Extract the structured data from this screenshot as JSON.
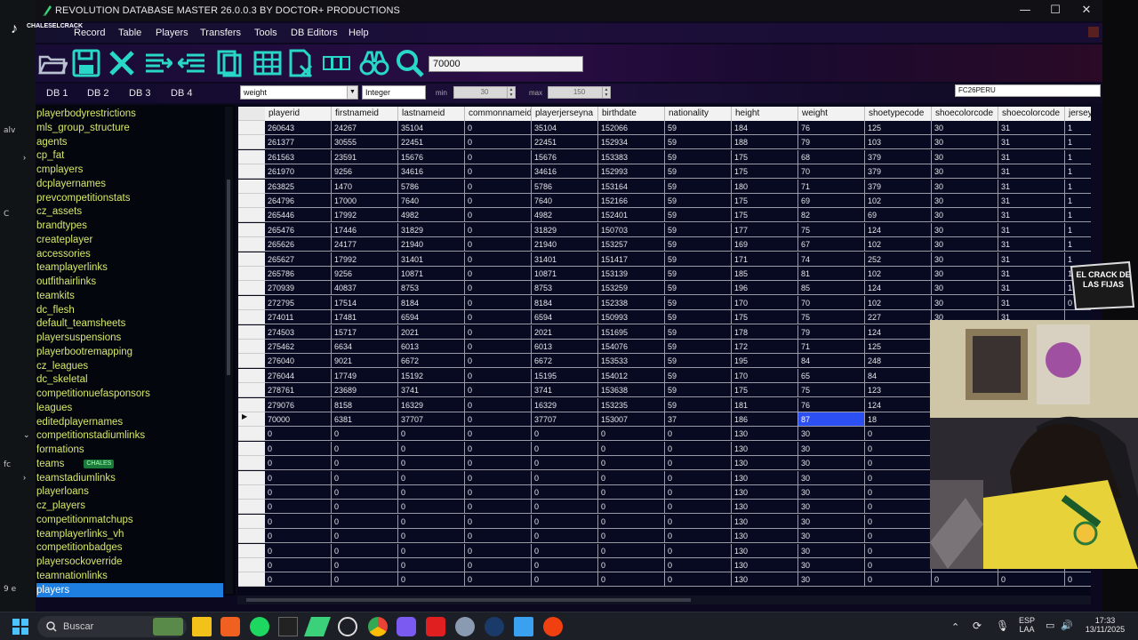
{
  "window": {
    "title": "REVOLUTION DATABASE MASTER 26.0.0.3 BY DOCTOR+ PRODUCTIONS",
    "minimize": "—",
    "maximize": "☐",
    "close": "✕"
  },
  "menu": [
    "Record",
    "Table",
    "Players",
    "Transfers",
    "Tools",
    "DB Editors",
    "Help"
  ],
  "search": {
    "value": "70000"
  },
  "db_tabs": [
    "DB 1",
    "DB 2",
    "DB 3",
    "DB 4"
  ],
  "field_bar": {
    "field": "weight",
    "type": "Integer",
    "min_label": "min",
    "min_value": "30",
    "max_label": "max",
    "max_value": "150",
    "filter": "FC26PERU"
  },
  "tables": [
    "playerbodyrestrictions",
    "mls_group_structure",
    "agents",
    "cp_fat",
    "cmplayers",
    "dcplayernames",
    "prevcompetitionstats",
    "cz_assets",
    "brandtypes",
    "createplayer",
    "accessories",
    "teamplayerlinks",
    "outfithairlinks",
    "teamkits",
    "dc_flesh",
    "default_teamsheets",
    "playersuspensions",
    "playerbootremapping",
    "cz_leagues",
    "dc_skeletal",
    "competitionuefasponsors",
    "leagues",
    "editedplayernames",
    "competitionstadiumlinks",
    "formations",
    "teams",
    "teamstadiumlinks",
    "playerloans",
    "cz_players",
    "competitionmatchups",
    "teamplayerlinks_vh",
    "competitionbadges",
    "playersockoverride",
    "teamnationlinks",
    "players"
  ],
  "teams_badge": "CHALES",
  "selected_table": "players",
  "columns": [
    "playerid",
    "firstnameid",
    "lastnameid",
    "commonnameid",
    "playerjerseyna",
    "birthdate",
    "nationality",
    "height",
    "weight",
    "shoetypecode",
    "shoecolorcode",
    "shoecolorcode",
    "jersey"
  ],
  "rows": [
    [
      "260643",
      "24267",
      "35104",
      "0",
      "35104",
      "152066",
      "59",
      "184",
      "76",
      "125",
      "30",
      "31",
      "1"
    ],
    [
      "261377",
      "30555",
      "22451",
      "0",
      "22451",
      "152934",
      "59",
      "188",
      "79",
      "103",
      "30",
      "31",
      "1"
    ],
    [
      "261563",
      "23591",
      "15676",
      "0",
      "15676",
      "153383",
      "59",
      "175",
      "68",
      "379",
      "30",
      "31",
      "1"
    ],
    [
      "261970",
      "9256",
      "34616",
      "0",
      "34616",
      "152993",
      "59",
      "175",
      "70",
      "379",
      "30",
      "31",
      "1"
    ],
    [
      "263825",
      "1470",
      "5786",
      "0",
      "5786",
      "153164",
      "59",
      "180",
      "71",
      "379",
      "30",
      "31",
      "1"
    ],
    [
      "264796",
      "17000",
      "7640",
      "0",
      "7640",
      "152166",
      "59",
      "175",
      "69",
      "102",
      "30",
      "31",
      "1"
    ],
    [
      "265446",
      "17992",
      "4982",
      "0",
      "4982",
      "152401",
      "59",
      "175",
      "82",
      "69",
      "30",
      "31",
      "1"
    ],
    [
      "265476",
      "17446",
      "31829",
      "0",
      "31829",
      "150703",
      "59",
      "177",
      "75",
      "124",
      "30",
      "31",
      "1"
    ],
    [
      "265626",
      "24177",
      "21940",
      "0",
      "21940",
      "153257",
      "59",
      "169",
      "67",
      "102",
      "30",
      "31",
      "1"
    ],
    [
      "265627",
      "17992",
      "31401",
      "0",
      "31401",
      "151417",
      "59",
      "171",
      "74",
      "252",
      "30",
      "31",
      "1"
    ],
    [
      "265786",
      "9256",
      "10871",
      "0",
      "10871",
      "153139",
      "59",
      "185",
      "81",
      "102",
      "30",
      "31",
      "1"
    ],
    [
      "270939",
      "40837",
      "8753",
      "0",
      "8753",
      "153259",
      "59",
      "196",
      "85",
      "124",
      "30",
      "31",
      "1"
    ],
    [
      "272795",
      "17514",
      "8184",
      "0",
      "8184",
      "152338",
      "59",
      "170",
      "70",
      "102",
      "30",
      "31",
      "0"
    ],
    [
      "274011",
      "17481",
      "6594",
      "0",
      "6594",
      "150993",
      "59",
      "175",
      "75",
      "227",
      "30",
      "31",
      ""
    ],
    [
      "274503",
      "15717",
      "2021",
      "0",
      "2021",
      "151695",
      "59",
      "178",
      "79",
      "124",
      "",
      "",
      ""
    ],
    [
      "275462",
      "6634",
      "6013",
      "0",
      "6013",
      "154076",
      "59",
      "172",
      "71",
      "125",
      "",
      "",
      ""
    ],
    [
      "276040",
      "9021",
      "6672",
      "0",
      "6672",
      "153533",
      "59",
      "195",
      "84",
      "248",
      "",
      "",
      ""
    ],
    [
      "276044",
      "17749",
      "15192",
      "0",
      "15195",
      "154012",
      "59",
      "170",
      "65",
      "84",
      "",
      "",
      ""
    ],
    [
      "278761",
      "23689",
      "3741",
      "0",
      "3741",
      "153638",
      "59",
      "175",
      "75",
      "123",
      "",
      "",
      ""
    ],
    [
      "279076",
      "8158",
      "16329",
      "0",
      "16329",
      "153235",
      "59",
      "181",
      "76",
      "124",
      "",
      "",
      ""
    ],
    [
      "70000",
      "6381",
      "37707",
      "0",
      "37707",
      "153007",
      "37",
      "186",
      "87",
      "18",
      "",
      "",
      ""
    ],
    [
      "0",
      "0",
      "0",
      "0",
      "0",
      "0",
      "0",
      "130",
      "30",
      "0",
      "",
      "",
      ""
    ],
    [
      "0",
      "0",
      "0",
      "0",
      "0",
      "0",
      "0",
      "130",
      "30",
      "0",
      "",
      "",
      ""
    ],
    [
      "0",
      "0",
      "0",
      "0",
      "0",
      "0",
      "0",
      "130",
      "30",
      "0",
      "",
      "",
      ""
    ],
    [
      "0",
      "0",
      "0",
      "0",
      "0",
      "0",
      "0",
      "130",
      "30",
      "0",
      "",
      "",
      ""
    ],
    [
      "0",
      "0",
      "0",
      "0",
      "0",
      "0",
      "0",
      "130",
      "30",
      "0",
      "",
      "",
      ""
    ],
    [
      "0",
      "0",
      "0",
      "0",
      "0",
      "0",
      "0",
      "130",
      "30",
      "0",
      "",
      "",
      ""
    ],
    [
      "0",
      "0",
      "0",
      "0",
      "0",
      "0",
      "0",
      "130",
      "30",
      "0",
      "",
      "",
      ""
    ],
    [
      "0",
      "0",
      "0",
      "0",
      "0",
      "0",
      "0",
      "130",
      "30",
      "0",
      "",
      "",
      ""
    ],
    [
      "0",
      "0",
      "0",
      "0",
      "0",
      "0",
      "0",
      "130",
      "30",
      "0",
      "",
      "",
      ""
    ],
    [
      "0",
      "0",
      "0",
      "0",
      "0",
      "0",
      "0",
      "130",
      "30",
      "0",
      "",
      "",
      ""
    ],
    [
      "0",
      "0",
      "0",
      "0",
      "0",
      "0",
      "0",
      "130",
      "30",
      "0",
      "0",
      "0",
      "0"
    ]
  ],
  "current_row_index": 20,
  "highlight_cell": {
    "row": 20,
    "col": 8
  },
  "overlay": {
    "tiktok_handle": "CHALESELCRACK",
    "crack_logo": "EL CRACK DE LAS FIJAS"
  },
  "taskbar": {
    "search_placeholder": "Buscar",
    "lang_top": "ESP",
    "lang_bottom": "LAA",
    "time": "17:33",
    "date": "13/11/2025"
  },
  "desktop_fragments": [
    "alv",
    "C",
    "fc",
    "9 e"
  ],
  "colors": {
    "list_text": "#d7e86a",
    "selection": "#1f7fe0",
    "cell_highlight": "#2b4ff0",
    "accent_green": "#1a7a3a"
  }
}
